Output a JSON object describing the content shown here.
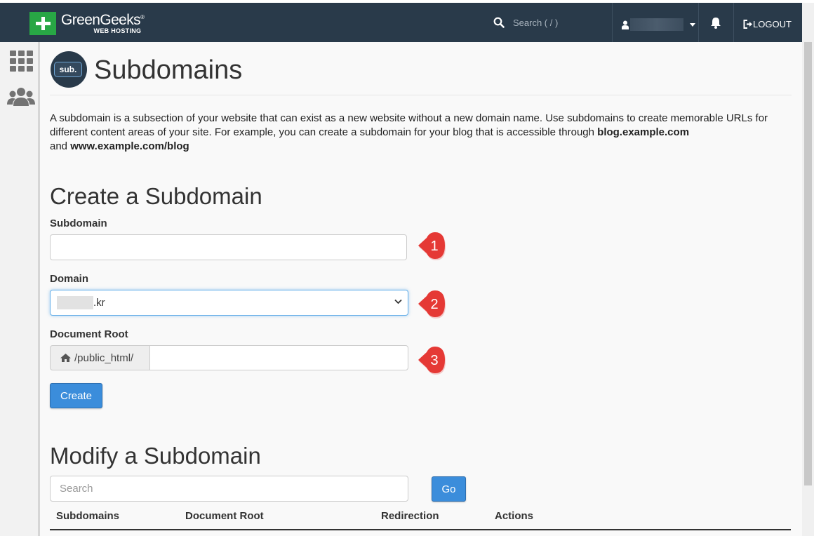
{
  "header": {
    "brand_name": "GreenGeeks",
    "brand_registered": "®",
    "brand_subtitle": "WEB HOSTING",
    "search_placeholder": "Search ( / )",
    "logout_label": "LOGOUT"
  },
  "sidebar": {
    "items": [
      {
        "icon": "apps-grid-icon"
      },
      {
        "icon": "users-icon"
      }
    ]
  },
  "page": {
    "icon_label": "sub.",
    "title": "Subdomains",
    "intro_text": "A subdomain is a subsection of your website that can exist as a new website without a new domain name. Use subdomains to create memorable URLs for different content areas of your site. For example, you can create a subdomain for your blog that is accessible through ",
    "intro_bold_1": "blog.example.com",
    "intro_and": " and ",
    "intro_bold_2": "www.example.com/blog"
  },
  "create": {
    "heading": "Create a Subdomain",
    "subdomain_label": "Subdomain",
    "subdomain_value": "",
    "domain_label": "Domain",
    "domain_value_suffix": ".kr",
    "docroot_label": "Document Root",
    "docroot_prefix": "/public_html/",
    "docroot_value": "",
    "create_button": "Create",
    "callouts": [
      "1",
      "2",
      "3"
    ]
  },
  "modify": {
    "heading": "Modify a Subdomain",
    "search_placeholder": "Search",
    "go_button": "Go",
    "columns": [
      "Subdomains",
      "Document Root",
      "Redirection",
      "Actions"
    ]
  },
  "colors": {
    "navbar": "#293a4a",
    "brand_green": "#28a745",
    "primary_button": "#3b8ddb",
    "callout_red": "#e53935"
  }
}
